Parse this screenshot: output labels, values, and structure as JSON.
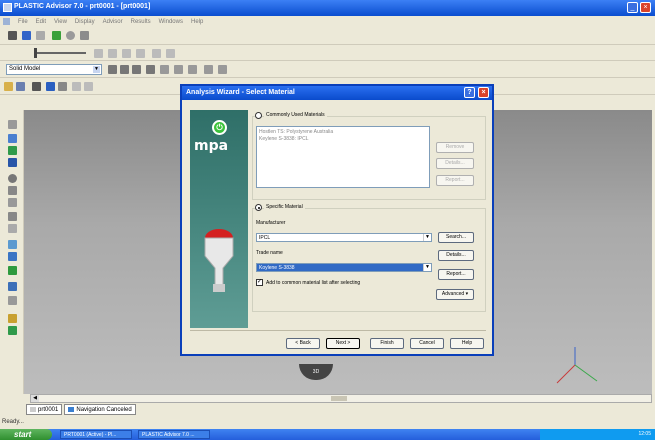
{
  "window": {
    "title": "PLASTIC Advisor 7.0 - prt0001 - [prt0001]"
  },
  "menu": [
    "File",
    "Edit",
    "View",
    "Display",
    "Advisor",
    "Results",
    "Windows",
    "Help"
  ],
  "toolbar": {
    "mode_select": "Solid Model"
  },
  "dialog": {
    "title": "Analysis Wizard - Select Material",
    "logo_text": "mpa",
    "common_group_label": "Commonly Used Materials",
    "common_list": [
      "Hostlen TS: Polystyrene Australia",
      "Keylene S-3838: IPCL"
    ],
    "remove_label": "Remove",
    "details_label_1": "Details...",
    "report_label_1": "Report...",
    "specific_group_label": "Specific Material",
    "manufacturer_label": "Manufacturer",
    "manufacturer_value": "IPCL",
    "search_label": "Search...",
    "trade_name_label": "Trade name",
    "trade_name_value": "Koylene S-3838",
    "details_label_2": "Details...",
    "report_label_2": "Report...",
    "add_checkbox_label": "Add to common material list after selecting",
    "add_checkbox_checked": true,
    "advanced_label": "Advanced",
    "back_label": "< Back",
    "next_label": "Next >",
    "finish_label": "Finish",
    "cancel_label": "Cancel",
    "help_label": "Help"
  },
  "viewport": {
    "tag": "3D"
  },
  "tabs": [
    {
      "label": "prt0001"
    },
    {
      "label": "Navigation Canceled"
    }
  ],
  "status": {
    "text": "Ready..."
  },
  "taskbar": {
    "start_label": "start",
    "tasks": [
      "PRT0001 (Active) - Pl...",
      "PLASTIC Advisor 7.0 ..."
    ],
    "clock": "12:05"
  }
}
